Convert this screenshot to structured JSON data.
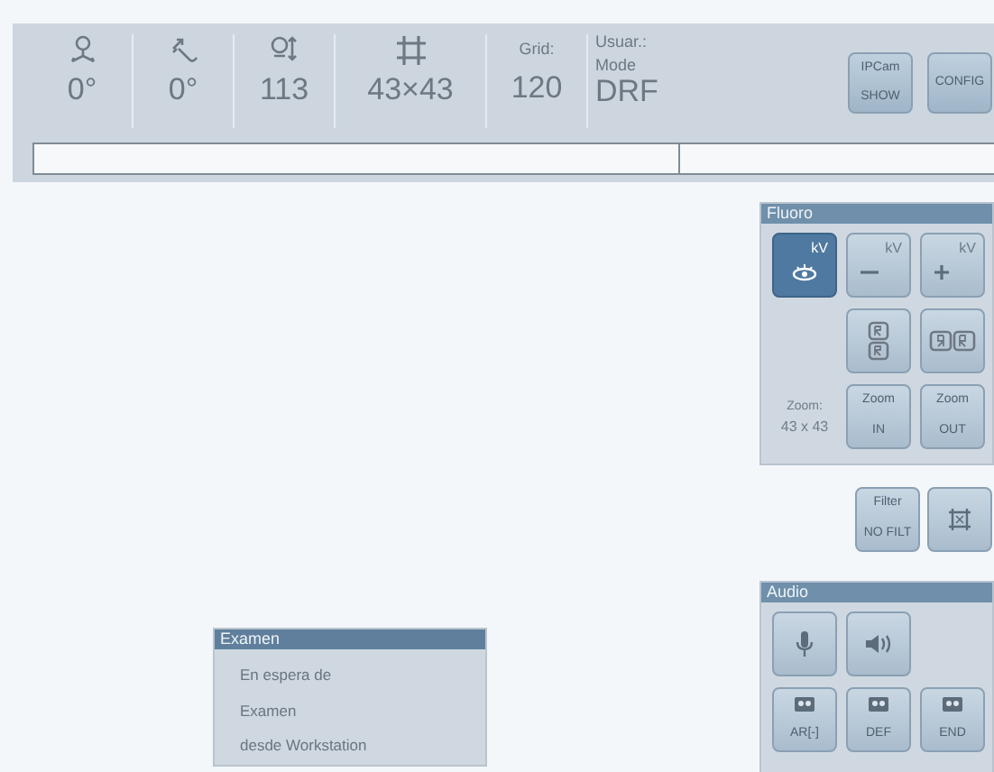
{
  "readouts": [
    {
      "kind": "rotation",
      "value": "0°"
    },
    {
      "kind": "angulation",
      "value": "0°"
    },
    {
      "kind": "height",
      "value": "113"
    },
    {
      "kind": "field",
      "value": "43×43"
    },
    {
      "kind": "grid",
      "label": "Grid:",
      "value": "120"
    },
    {
      "kind": "mode",
      "label": "Usuar.:",
      "label2": "Mode",
      "value": "DRF"
    }
  ],
  "header_buttons": [
    {
      "line1": "IPCam",
      "line2": "SHOW"
    },
    {
      "line1": "CONFIG"
    }
  ],
  "fluoro": {
    "title": "Fluoro",
    "buttons": [
      {
        "kind": "kv-auto",
        "label": "kV",
        "selected": true
      },
      {
        "kind": "kv-minus",
        "label": "kV",
        "selected": false
      },
      {
        "kind": "kv-plus",
        "label": "kV",
        "selected": false
      }
    ],
    "orient_buttons": [
      {
        "kind": "flip-vertical"
      },
      {
        "kind": "flip-horizontal"
      }
    ],
    "zoom_label": "Zoom:",
    "zoom_value": "43 x 43",
    "zoom_buttons": [
      {
        "line1": "Zoom",
        "line2": "IN"
      },
      {
        "line1": "Zoom",
        "line2": "OUT"
      }
    ]
  },
  "filter_buttons": [
    {
      "kind": "text",
      "line1": "Filter",
      "line2": "NO FILT"
    },
    {
      "kind": "collimator"
    }
  ],
  "audio": {
    "title": "Audio",
    "buttons": [
      {
        "kind": "microphone"
      },
      {
        "kind": "speaker"
      }
    ],
    "tape_buttons": [
      {
        "label": "AR[-]"
      },
      {
        "label": "DEF"
      },
      {
        "label": "END"
      }
    ]
  },
  "exam": {
    "title": "Examen",
    "lines": [
      "En espera de",
      "Examen",
      "desde Workstation"
    ]
  }
}
